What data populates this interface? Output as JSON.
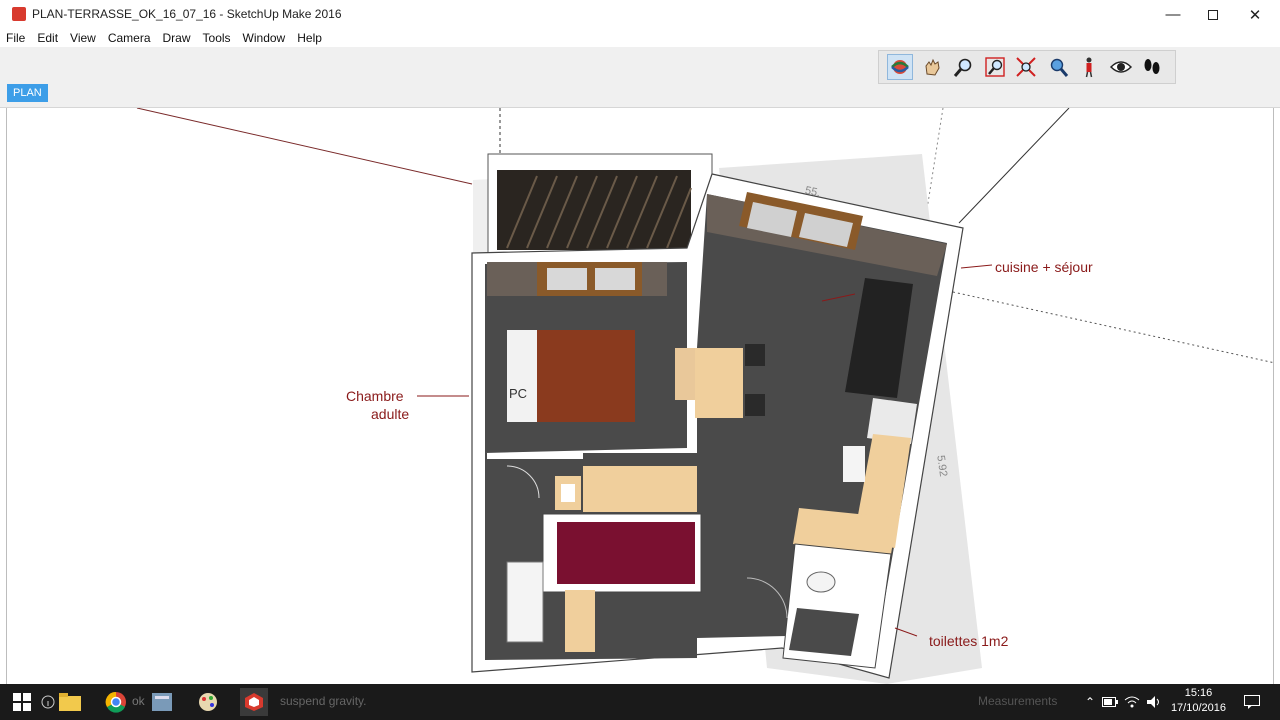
{
  "window": {
    "title": "PLAN-TERRASSE_OK_16_07_16 - SketchUp Make 2016",
    "minimize_icon": "minimize-icon",
    "maximize_icon": "maximize-icon",
    "close_icon": "close-icon"
  },
  "menu": {
    "items": [
      "File",
      "Edit",
      "View",
      "Camera",
      "Draw",
      "Tools",
      "Window",
      "Help"
    ]
  },
  "toolbar": {
    "tools": [
      "orbit-icon",
      "pan-icon",
      "zoom-icon",
      "zoom-window-icon",
      "zoom-extents-icon",
      "previous-view-icon",
      "position-camera-icon",
      "look-around-icon",
      "walk-icon"
    ]
  },
  "scene_tab": {
    "label": "PLAN"
  },
  "annotations": {
    "chambre_line1": "Chambre",
    "chambre_line2": "adulte",
    "cuisine": "cuisine + séjour",
    "toilettes": "toilettes  1m2",
    "pc": "PC",
    "dim_top": "55.",
    "dim_right": "5.92"
  },
  "statusbar": {
    "hint_pre": "ok",
    "hint_post": "suspend gravity.",
    "measurements_label": "Measurements"
  },
  "taskbar": {
    "time": "15:16",
    "date": "17/10/2016"
  },
  "colors": {
    "accent": "#3d9ee8",
    "annotation": "#8a1a1a",
    "floor": "#4a4a4a",
    "bed": "#8a3a1e",
    "rug": "#7a1030"
  }
}
